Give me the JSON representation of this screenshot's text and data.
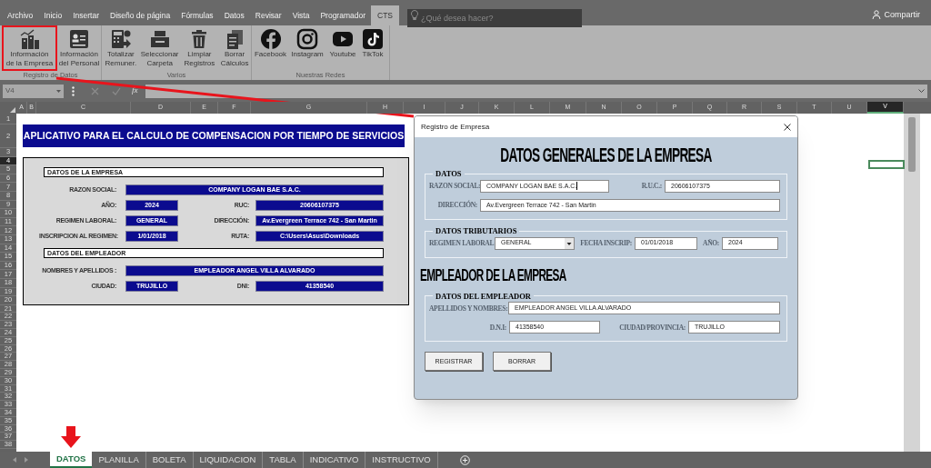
{
  "menu_tabs": [
    {
      "label": "Archivo",
      "selected": false
    },
    {
      "label": "Inicio",
      "selected": false
    },
    {
      "label": "Insertar",
      "selected": false
    },
    {
      "label": "Diseño de página",
      "selected": false
    },
    {
      "label": "Fórmulas",
      "selected": false
    },
    {
      "label": "Datos",
      "selected": false
    },
    {
      "label": "Revisar",
      "selected": false
    },
    {
      "label": "Vista",
      "selected": false
    },
    {
      "label": "Programador",
      "selected": false
    },
    {
      "label": "CTS",
      "selected": true
    }
  ],
  "search": {
    "placeholder": "¿Qué desea hacer?"
  },
  "share_button": "Compartir",
  "ribbon_groups": [
    {
      "label": "Registro de Datos",
      "buttons": [
        {
          "lines": [
            "Información",
            "de la Empresa"
          ],
          "kind": "buildings",
          "highlighted": true
        },
        {
          "lines": [
            "Información",
            "del Personal"
          ],
          "kind": "id-card",
          "highlighted": false
        }
      ]
    },
    {
      "label": "Varios",
      "buttons": [
        {
          "lines": [
            "Totalizar",
            "Remuner."
          ],
          "kind": "calculator",
          "highlighted": false
        },
        {
          "lines": [
            "Seleccionar",
            "Carpeta"
          ],
          "kind": "tray",
          "highlighted": false
        },
        {
          "lines": [
            "Limpiar",
            "Registros"
          ],
          "kind": "trash",
          "highlighted": false
        },
        {
          "lines": [
            "Borrar",
            "Cálculos"
          ],
          "kind": "document",
          "highlighted": false
        }
      ]
    },
    {
      "label": "Nuestras Redes",
      "buttons": [
        {
          "lines": [
            "Facebook"
          ],
          "kind": "circle-logo",
          "highlighted": false
        },
        {
          "lines": [
            "Instagram"
          ],
          "kind": "camera",
          "highlighted": false
        },
        {
          "lines": [
            "Youtube"
          ],
          "kind": "play",
          "highlighted": false
        },
        {
          "lines": [
            "TikTok"
          ],
          "kind": "note",
          "highlighted": false
        }
      ]
    }
  ],
  "formula_bar": {
    "name_box": "V4",
    "function_label": "fx"
  },
  "columns": [
    {
      "label": "A",
      "selected": false
    },
    {
      "label": "B",
      "selected": false
    },
    {
      "label": "C",
      "selected": false
    },
    {
      "label": "D",
      "selected": false
    },
    {
      "label": "E",
      "selected": false
    },
    {
      "label": "F",
      "selected": false
    },
    {
      "label": "G",
      "selected": false
    },
    {
      "label": "H",
      "selected": false
    },
    {
      "label": "I",
      "selected": false
    },
    {
      "label": "J",
      "selected": false
    },
    {
      "label": "K",
      "selected": false
    },
    {
      "label": "L",
      "selected": false
    },
    {
      "label": "M",
      "selected": false
    },
    {
      "label": "N",
      "selected": false
    },
    {
      "label": "O",
      "selected": false
    },
    {
      "label": "P",
      "selected": false
    },
    {
      "label": "Q",
      "selected": false
    },
    {
      "label": "R",
      "selected": false
    },
    {
      "label": "S",
      "selected": false
    },
    {
      "label": "T",
      "selected": false
    },
    {
      "label": "U",
      "selected": false
    },
    {
      "label": "V",
      "selected": true
    }
  ],
  "rows": [
    {
      "label": "1",
      "selected": false
    },
    {
      "label": "2",
      "selected": false
    },
    {
      "label": "3",
      "selected": false
    },
    {
      "label": "4",
      "selected": true
    },
    {
      "label": "5",
      "selected": false
    },
    {
      "label": "6",
      "selected": false
    },
    {
      "label": "7",
      "selected": false
    },
    {
      "label": "8",
      "selected": false
    },
    {
      "label": "9",
      "selected": false
    },
    {
      "label": "10",
      "selected": false
    },
    {
      "label": "11",
      "selected": false
    },
    {
      "label": "12",
      "selected": false
    },
    {
      "label": "13",
      "selected": false
    },
    {
      "label": "14",
      "selected": false
    },
    {
      "label": "15",
      "selected": false
    },
    {
      "label": "16",
      "selected": false
    },
    {
      "label": "17",
      "selected": false
    },
    {
      "label": "18",
      "selected": false
    },
    {
      "label": "19",
      "selected": false
    },
    {
      "label": "20",
      "selected": false
    },
    {
      "label": "21",
      "selected": false
    },
    {
      "label": "22",
      "selected": false
    },
    {
      "label": "23",
      "selected": false
    },
    {
      "label": "24",
      "selected": false
    },
    {
      "label": "25",
      "selected": false
    },
    {
      "label": "26",
      "selected": false
    },
    {
      "label": "27",
      "selected": false
    },
    {
      "label": "28",
      "selected": false
    },
    {
      "label": "29",
      "selected": false
    },
    {
      "label": "30",
      "selected": false
    },
    {
      "label": "31",
      "selected": false
    },
    {
      "label": "32",
      "selected": false
    },
    {
      "label": "33",
      "selected": false
    },
    {
      "label": "34",
      "selected": false
    },
    {
      "label": "35",
      "selected": false
    },
    {
      "label": "36",
      "selected": false
    },
    {
      "label": "37",
      "selected": false
    },
    {
      "label": "38",
      "selected": false
    }
  ],
  "sheet": {
    "title": "APLICATIVO PARA EL CALCULO DE COMPENSACION POR TIEMPO DE SERVICIOS",
    "sections": [
      {
        "heading": "DATOS DE LA EMPRESA",
        "rows": [
          [
            {
              "label": "RAZON SOCIAL:",
              "value": "COMPANY LOGAN BAE S.A.C."
            }
          ],
          [
            {
              "label": "AÑO:",
              "value": "2024"
            },
            {
              "label": "RUC:",
              "value": "20606107375"
            }
          ],
          [
            {
              "label": "REGIMEN LABORAL:",
              "value": "GENERAL"
            },
            {
              "label": "DIRECCIÓN:",
              "value": "Av.Evergreen Terrace 742 - San Martin"
            }
          ],
          [
            {
              "label": "INSCRIPCION AL REGIMEN:",
              "value": "1/01/2018"
            },
            {
              "label": "RUTA:",
              "value": "C:\\Users\\Asus\\Downloads"
            }
          ]
        ]
      },
      {
        "heading": "DATOS DEL EMPLEADOR",
        "rows": [
          [
            {
              "label": "NOMBRES Y APELLIDOS :",
              "value": "EMPLEADOR ANGEL VILLA ALVARADO"
            }
          ],
          [
            {
              "label": "CIUDAD:",
              "value": "TRUJILLO"
            },
            {
              "label": "DNI:",
              "value": "41358540"
            }
          ]
        ]
      }
    ]
  },
  "dialog": {
    "title": "Registro de Empresa",
    "sections": [
      {
        "kind": "title",
        "text": "DATOS GENERALES DE LA EMPRESA"
      },
      {
        "kind": "frame",
        "legend": "DATOS",
        "rows": [
          [
            {
              "label": "RAZON SOCIAL:",
              "value": "COMPANY LOGAN BAE S.A.C.",
              "kind": "text",
              "focused": true
            },
            {
              "label": "R.U.C.:",
              "value": "20606107375",
              "kind": "text",
              "focused": false
            }
          ],
          [
            {
              "label": "DIRECCIÓN:",
              "value": "Av.Evergreen Terrace 742 - San Martin",
              "kind": "text",
              "focused": false
            }
          ]
        ]
      },
      {
        "kind": "frame",
        "legend": "DATOS TRIBUTARIOS",
        "rows": [
          [
            {
              "label": "REGIMEN LABORAL:",
              "value": "GENERAL",
              "kind": "dropdown",
              "focused": false
            },
            {
              "label": "FECHA INSCRIP:",
              "value": "01/01/2018",
              "kind": "text",
              "focused": false
            },
            {
              "label": "AÑO:",
              "value": "2024",
              "kind": "text",
              "focused": false
            }
          ]
        ]
      },
      {
        "kind": "heading",
        "text": "EMPLEADOR DE LA EMPRESA"
      },
      {
        "kind": "frame",
        "legend": "DATOS DEL EMPLEADOR",
        "rows": [
          [
            {
              "label": "APELLIDOS Y NOMBRES:",
              "value": "EMPLEADOR ANGEL VILLA ALVARADO",
              "kind": "text",
              "focused": false
            }
          ],
          [
            {
              "label": "D.N.I:",
              "value": "41358540",
              "kind": "text",
              "focused": false
            },
            {
              "label": "CIUDAD/PROVINCIA:",
              "value": "TRUJILLO",
              "kind": "text",
              "focused": false
            }
          ]
        ]
      }
    ],
    "buttons": [
      "REGISTRAR",
      "BORRAR"
    ]
  },
  "sheet_tabs": [
    {
      "label": "DATOS",
      "selected": true,
      "marked": true
    },
    {
      "label": "PLANILLA",
      "selected": false,
      "marked": false
    },
    {
      "label": "BOLETA",
      "selected": false,
      "marked": false
    },
    {
      "label": "LIQUIDACION",
      "selected": false,
      "marked": false
    },
    {
      "label": "TABLA",
      "selected": false,
      "marked": false
    },
    {
      "label": "INDICATIVO",
      "selected": false,
      "marked": false
    },
    {
      "label": "INSTRUCTIVO",
      "selected": false,
      "marked": false
    }
  ]
}
